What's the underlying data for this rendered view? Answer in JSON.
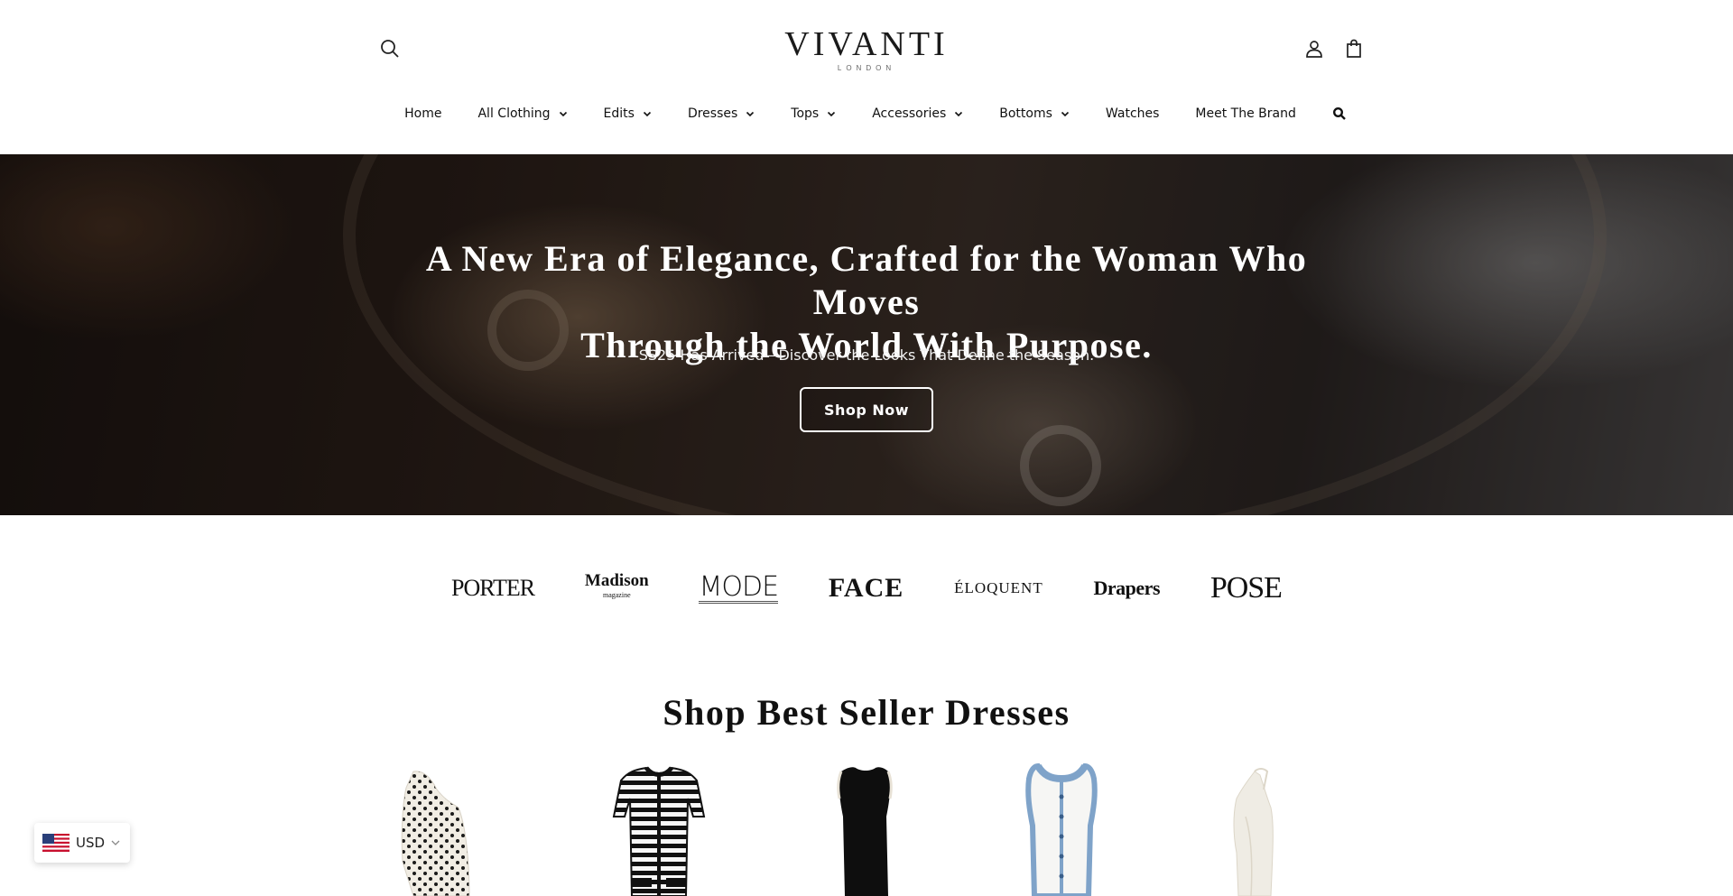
{
  "header": {
    "logo_main": "VIVANTI",
    "logo_sub": "LONDON",
    "search_icon": "search-icon",
    "account_icon": "user-icon",
    "cart_icon": "shopping-bag-icon"
  },
  "nav": {
    "items": [
      {
        "label": "Home",
        "dropdown": false
      },
      {
        "label": "All Clothing",
        "dropdown": true
      },
      {
        "label": "Edits",
        "dropdown": true
      },
      {
        "label": "Dresses",
        "dropdown": true
      },
      {
        "label": "Tops",
        "dropdown": true
      },
      {
        "label": "Accessories",
        "dropdown": true
      },
      {
        "label": "Bottoms",
        "dropdown": true
      },
      {
        "label": "Watches",
        "dropdown": false
      },
      {
        "label": "Meet The Brand",
        "dropdown": false
      }
    ],
    "search_icon": "search-icon"
  },
  "hero": {
    "title_line1": "A New Era of Elegance, Crafted for the Woman Who Moves",
    "title_line2": "Through the World With Purpose.",
    "subtitle": "SS25 Has Arrived—Discover the Looks That Define the Season.",
    "cta_label": "Shop Now"
  },
  "press": {
    "logos": [
      {
        "name": "porter-logo",
        "text": "PORTER"
      },
      {
        "name": "madison-logo",
        "text": "Madison",
        "sub": "magazine"
      },
      {
        "name": "mode-logo",
        "text": "MODE"
      },
      {
        "name": "face-logo",
        "text": "FACE"
      },
      {
        "name": "eloquent-logo",
        "text": "ÉLOQUENT"
      },
      {
        "name": "drapers-logo",
        "text": "Drapers"
      },
      {
        "name": "pose-logo",
        "text": "POSE"
      }
    ]
  },
  "best_sellers": {
    "title": "Shop Best Seller Dresses",
    "products": [
      {
        "name": "polka-dot-one-shoulder-dress",
        "image": "cream dress with black polka dots"
      },
      {
        "name": "striped-knit-dress",
        "image": "black and white striped knit dress"
      },
      {
        "name": "black-sleeveless-dress",
        "image": "black sleeveless midi dress"
      },
      {
        "name": "denim-trim-white-dress",
        "image": "white dress with blue denim trim"
      },
      {
        "name": "ivory-halter-dress",
        "image": "ivory halter neck dress"
      }
    ]
  },
  "currency": {
    "label": "USD",
    "flag_icon": "us-flag-icon"
  },
  "colors": {
    "text": "#111111",
    "hero_text": "#ffffff",
    "background": "#ffffff"
  }
}
